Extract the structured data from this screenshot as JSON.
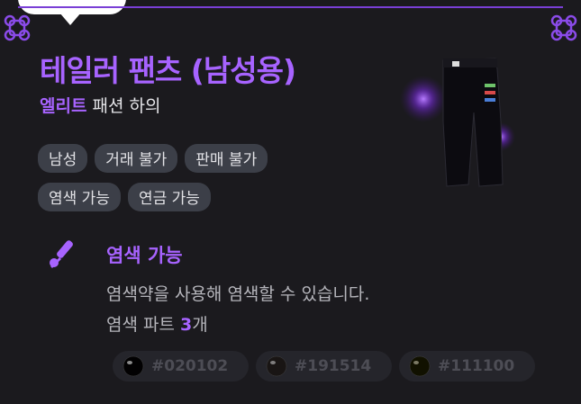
{
  "item": {
    "name": "테일러 팬츠 (남성용)",
    "grade": "엘리트",
    "category": "패션 하의",
    "tags_row1": [
      "남성",
      "거래 불가",
      "판매 불가"
    ],
    "tags_row2": [
      "염색 가능",
      "연금 가능"
    ]
  },
  "dye": {
    "title": "염색 가능",
    "description": "염색약을 사용해 염색할 수 있습니다.",
    "parts_label": "염색 파트",
    "parts_count": "3",
    "parts_suffix": "개",
    "swatches": [
      {
        "code": "#020102",
        "color": "#020102"
      },
      {
        "code": "#191514",
        "color": "#191514"
      },
      {
        "code": "#111100",
        "color": "#111100"
      }
    ]
  },
  "colors": {
    "accent": "#a763ff",
    "frame": "#7a3fd6",
    "background": "#1b1a1e",
    "tag_bg": "#3c3f48"
  },
  "icons": {
    "corner": "ornament-corner-icon",
    "dye": "dye-brush-icon",
    "item": "pants-item-image"
  }
}
